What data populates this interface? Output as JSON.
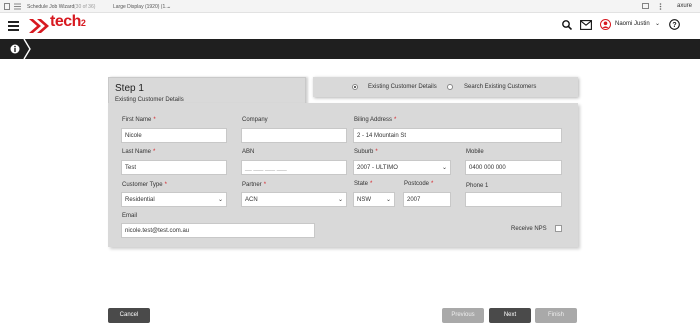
{
  "axure_bar": {
    "page_name": "Schedule Job Wizard",
    "page_count": "(30 of 36)",
    "display": "Large Display (1920) (1...",
    "brand": "axure"
  },
  "header": {
    "logo_text": "tech",
    "logo_sup": "2",
    "user_name": "Naomi Justin"
  },
  "step": {
    "title": "Step 1",
    "subtitle": "Existing Customer Details"
  },
  "mode": {
    "option1": "Existing Customer Details",
    "option2": "Search Existing Customers",
    "selected": "option1"
  },
  "form": {
    "first_name_label": "First Name",
    "first_name_value": "Nicole",
    "company_label": "Company",
    "company_value": "",
    "billing_label": "Biling Address",
    "billing_value": "2 - 14 Mountain St",
    "last_name_label": "Last Name",
    "last_name_value": "Test",
    "abn_label": "ABN",
    "abn_placeholder": "__ ___ ___ ___",
    "suburb_label": "Suburb",
    "suburb_value": "2007 - ULTIMO",
    "mobile_label": "Mobile",
    "mobile_value": "0400 000 000",
    "customer_type_label": "Customer Type",
    "customer_type_value": "Residential",
    "partner_label": "Partner",
    "partner_value": "ACN",
    "state_label": "State",
    "state_value": "NSW",
    "postcode_label": "Postcode",
    "postcode_value": "2007",
    "phone1_label": "Phone 1",
    "phone1_value": "",
    "email_label": "Email",
    "email_value": "nicole.test@test.com.au",
    "receive_nps_label": "Receive NPS",
    "required_mark": "*"
  },
  "buttons": {
    "cancel": "Cancel",
    "previous": "Previous",
    "next": "Next",
    "finish": "Finish"
  },
  "colors": {
    "brand_red": "#d71920",
    "dark_button": "#4a4a4a",
    "disabled_button": "#a9a9a9"
  },
  "icons": [
    "menu-icon",
    "search-icon",
    "mail-icon",
    "user-avatar-icon",
    "help-icon",
    "info-icon",
    "chevron-right-icon"
  ]
}
